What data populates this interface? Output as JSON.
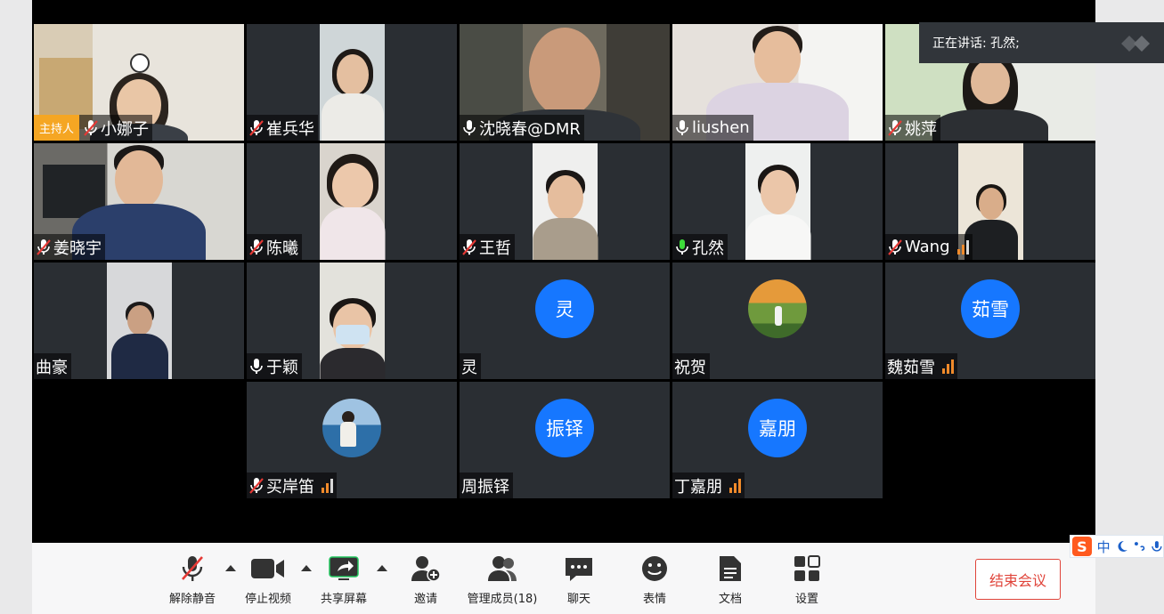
{
  "speaking": {
    "text": "正在讲话: 孔然;"
  },
  "host_badge": "主持人",
  "participants": [
    {
      "name": "小娜子",
      "host": true
    },
    {
      "name": "崔兵华"
    },
    {
      "name": "沈晓春@DMR"
    },
    {
      "name": "liushen"
    },
    {
      "name": "姚萍"
    },
    {
      "name": "姜晓宇"
    },
    {
      "name": "陈曦"
    },
    {
      "name": "王哲"
    },
    {
      "name": "孔然"
    },
    {
      "name": "Wang"
    },
    {
      "name": "曲豪"
    },
    {
      "name": "于颖"
    },
    {
      "name": "灵",
      "avatar_text": "灵"
    },
    {
      "name": "祝贺"
    },
    {
      "name": "魏茹雪",
      "avatar_text": "茹雪"
    },
    {
      "name": "买岸笛"
    },
    {
      "name": "周振铎",
      "avatar_text": "振铎"
    },
    {
      "name": "丁嘉朋",
      "avatar_text": "嘉朋"
    }
  ],
  "toolbar": {
    "unmute": "解除静音",
    "stop_video": "停止视频",
    "share_screen": "共享屏幕",
    "invite": "邀请",
    "manage_members": "管理成员(18)",
    "chat": "聊天",
    "reactions": "表情",
    "docs": "文档",
    "settings": "设置",
    "end_meeting": "结束会议"
  },
  "ime": {
    "label": "中"
  },
  "colors": {
    "accent_blue": "#1677ff",
    "host_orange": "#f5a623",
    "end_red": "#e0443a",
    "signal_orange": "#f08a2a"
  }
}
